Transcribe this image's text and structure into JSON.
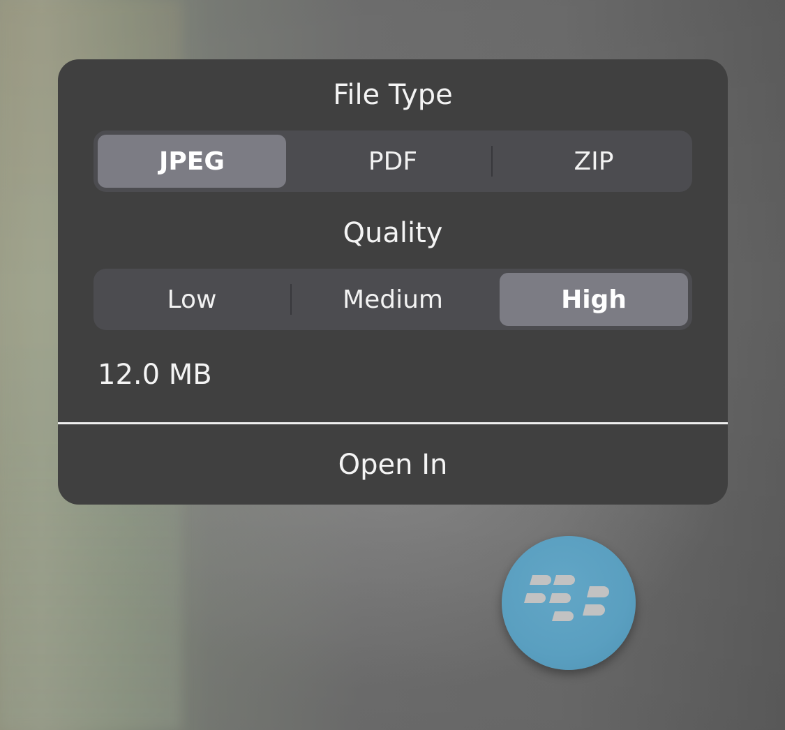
{
  "sheet": {
    "file_type_title": "File Type",
    "file_type_options": [
      {
        "label": "JPEG",
        "selected": true
      },
      {
        "label": "PDF",
        "selected": false
      },
      {
        "label": "ZIP",
        "selected": false
      }
    ],
    "quality_title": "Quality",
    "quality_options": [
      {
        "label": "Low",
        "selected": false
      },
      {
        "label": "Medium",
        "selected": false
      },
      {
        "label": "High",
        "selected": true
      }
    ],
    "file_size": "12.0 MB",
    "open_in_label": "Open In"
  },
  "floating_button": {
    "icon": "blackberry-logo-icon",
    "color": "#5a9fc0"
  },
  "colors": {
    "panel": "#404040",
    "segment_track": "#4c4c50",
    "segment_selected": "#7c7c84"
  }
}
